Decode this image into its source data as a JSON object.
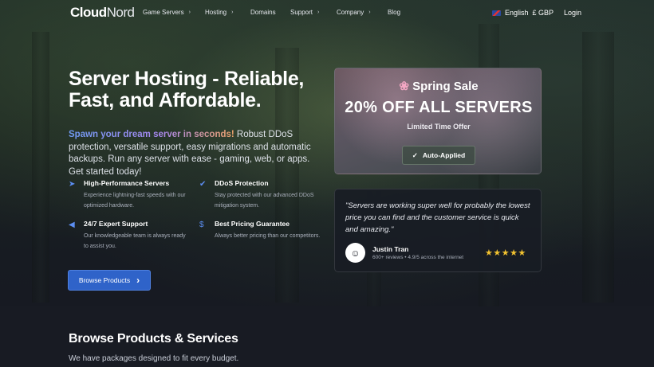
{
  "nav": {
    "logo_cloud": "Cloud",
    "logo_nord": "Nord",
    "items": [
      {
        "label": "Game Servers",
        "has_chevron": true
      },
      {
        "label": "Hosting",
        "has_chevron": true
      },
      {
        "label": "Domains",
        "has_chevron": false
      },
      {
        "label": "Support",
        "has_chevron": true
      },
      {
        "label": "Company",
        "has_chevron": true
      },
      {
        "label": "Blog",
        "has_chevron": false
      }
    ],
    "language": "English",
    "currency": "£ GBP",
    "login": "Login"
  },
  "hero": {
    "title": "Server Hosting - Reliable, Fast, and Affordable.",
    "intro_highlight": "Spawn your dream server in seconds!",
    "intro_text": " Robust DDoS protection, versatile support, easy migrations and automatic backups. Run any server with ease - gaming, web, or apps. Get started today!",
    "features": [
      {
        "icon": "rocket-icon",
        "title": "High-Performance Servers",
        "desc": "Experience lightning-fast speeds with our optimized hardware."
      },
      {
        "icon": "shield-check-icon",
        "title": "DDoS Protection",
        "desc": "Stay protected with our advanced DDoS mitigation system."
      },
      {
        "icon": "megaphone-icon",
        "title": "24/7 Expert Support",
        "desc": "Our knowledgeable team is always ready to assist you."
      },
      {
        "icon": "dollar-icon",
        "title": "Best Pricing Guarantee",
        "desc": "Always better pricing than our competitors."
      }
    ],
    "browse_button": "Browse Products"
  },
  "sale": {
    "title": "Spring Sale",
    "headline": "20% OFF ALL SERVERS",
    "subtitle": "Limited Time Offer",
    "applied": "Auto-Applied"
  },
  "review": {
    "quote": "\"Servers are working super well for probably the lowest price you can find and the customer service is quick and amazing.\"",
    "name": "Justin Tran",
    "meta": "600+ reviews • 4.9/5 across the internet",
    "stars": 5
  },
  "products": {
    "heading": "Browse Products & Services",
    "subheading": "We have packages designed to fit every budget."
  },
  "colors": {
    "accent": "#2f63c9",
    "icon": "#5c8ef2",
    "star": "#f2c230"
  }
}
